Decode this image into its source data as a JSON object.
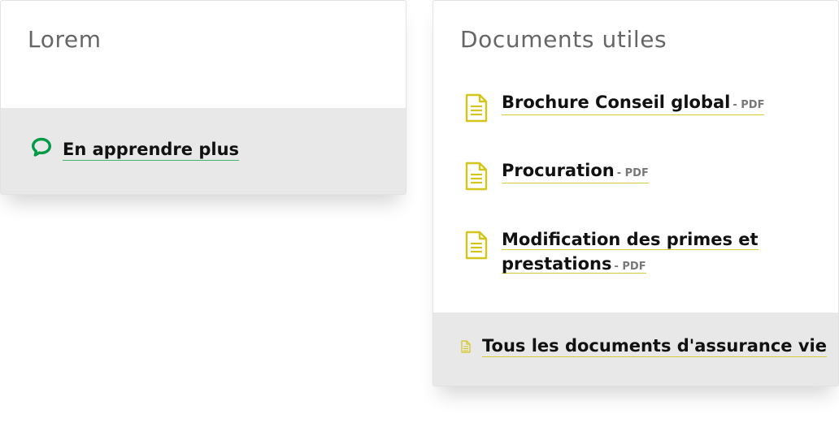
{
  "left_card": {
    "title": "Lorem",
    "footer_link": {
      "icon": "chat-bubble-icon",
      "label": "En apprendre plus"
    }
  },
  "right_card": {
    "title": "Documents utiles",
    "documents": [
      {
        "icon": "document-icon",
        "label": "Brochure Conseil global",
        "type": "- PDF"
      },
      {
        "icon": "document-icon",
        "label": "Procuration",
        "type": "- PDF"
      },
      {
        "icon": "document-icon",
        "label_line1": "Modification des primes et",
        "label_line2": "prestations",
        "type": "- PDF"
      }
    ],
    "footer_link": {
      "icon": "document-icon",
      "label": "Tous les documents d'assurance vie"
    }
  },
  "colors": {
    "accent_green": "#009a44",
    "accent_yellow": "#d4c51a",
    "footer_bg": "#e8e8e8",
    "title_gray": "#666666"
  }
}
